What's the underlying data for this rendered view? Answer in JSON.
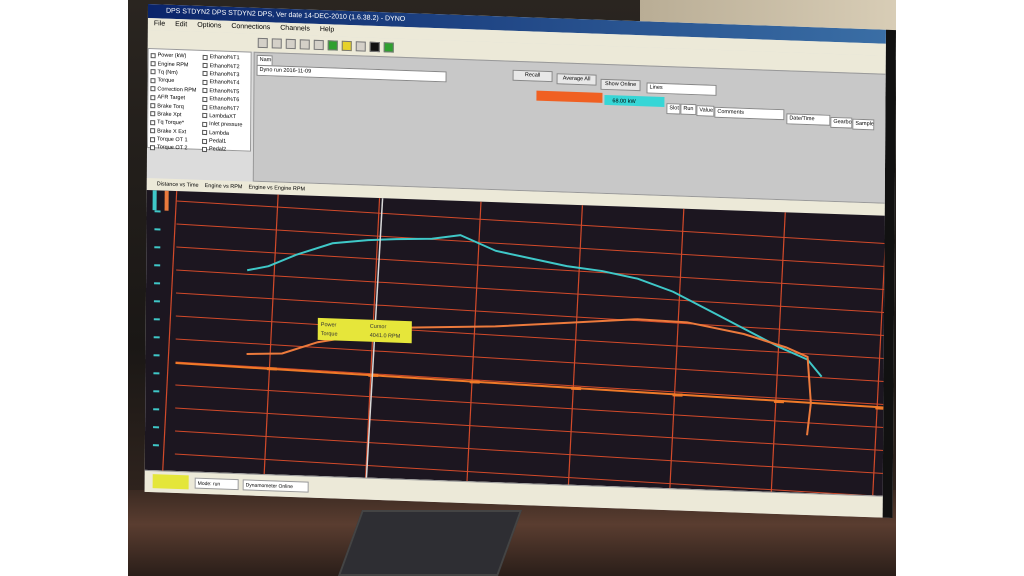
{
  "window": {
    "title": "DPS STDYN2 DPS STDYN2 DPS, Ver date 14-DEC-2010 (1.6.38.2) - DYNO"
  },
  "menu": [
    "File",
    "Edit",
    "Options",
    "Connections",
    "Channels",
    "Help"
  ],
  "left_panel": {
    "col1": [
      "Power (kW)",
      "Engine RPM",
      "Tq (Nm)",
      "Torque",
      "Correction RPM",
      "AFR Target",
      "Brake Torq",
      "Brake Xpt",
      "Tq Torque*",
      "Brake X Ext",
      "Torque OT 1",
      "Torque OT 2"
    ],
    "col2": [
      "Ethanol%T1",
      "Ethanol%T2",
      "Ethanol%T3",
      "Ethanol%T4",
      "Ethanol%T5",
      "Ethanol%T6",
      "Ethanol%T7",
      "LambdaXT",
      "Inlet pressure",
      "Lambda",
      "Pedal1",
      "Pedal2"
    ]
  },
  "controls": {
    "name_label": "Name",
    "run_name": "Dyno run 2016-11-09",
    "recall_button": "Recall",
    "average_button": "Average All",
    "show_online_button": "Show Online",
    "display_select": "Lines",
    "slot_header": "Slot",
    "run_header": "Run",
    "value_header": "Value",
    "comments_header": "Comments",
    "date_header": "Date/Time",
    "gearbox_header": "Gearbox",
    "sample_header": "Sample",
    "channel_value": "68.00 kW"
  },
  "chart_tabs": [
    "Distance vs Time",
    "Engine vs RPM",
    "Engine vs Engine RPM"
  ],
  "cursor_box": {
    "row1_label": "Power",
    "row1_value": "Cursor",
    "row2_label": "Torque",
    "row2_value": "4041.0 RPM"
  },
  "status": {
    "cell1": "Mode: run",
    "cell2": "Dynamometer Online"
  },
  "colors": {
    "power_trace": "#3fc8c8",
    "torque_trace": "#ec7a3c",
    "grid": "#d24a2a",
    "background": "#1c1620",
    "cursor_box": "#e6e63a"
  },
  "chart_data": {
    "type": "line",
    "series": [
      {
        "name": "Power",
        "points": [
          [
            0.1,
            0.24
          ],
          [
            0.13,
            0.22
          ],
          [
            0.17,
            0.17
          ],
          [
            0.22,
            0.12
          ],
          [
            0.27,
            0.1
          ],
          [
            0.31,
            0.09
          ],
          [
            0.36,
            0.08
          ],
          [
            0.4,
            0.06
          ],
          [
            0.45,
            0.11
          ],
          [
            0.5,
            0.13
          ],
          [
            0.55,
            0.15
          ],
          [
            0.6,
            0.16
          ],
          [
            0.65,
            0.18
          ],
          [
            0.7,
            0.22
          ],
          [
            0.75,
            0.28
          ],
          [
            0.8,
            0.34
          ],
          [
            0.85,
            0.4
          ],
          [
            0.89,
            0.44
          ],
          [
            0.91,
            0.5
          ]
        ]
      },
      {
        "name": "Torque",
        "points": [
          [
            0.1,
            0.55
          ],
          [
            0.15,
            0.54
          ],
          [
            0.2,
            0.49
          ],
          [
            0.25,
            0.46
          ],
          [
            0.3,
            0.42
          ],
          [
            0.35,
            0.41
          ],
          [
            0.45,
            0.39
          ],
          [
            0.55,
            0.36
          ],
          [
            0.65,
            0.33
          ],
          [
            0.72,
            0.33
          ],
          [
            0.8,
            0.36
          ],
          [
            0.86,
            0.4
          ],
          [
            0.89,
            0.43
          ],
          [
            0.895,
            0.6
          ],
          [
            0.89,
            0.72
          ]
        ]
      }
    ]
  }
}
